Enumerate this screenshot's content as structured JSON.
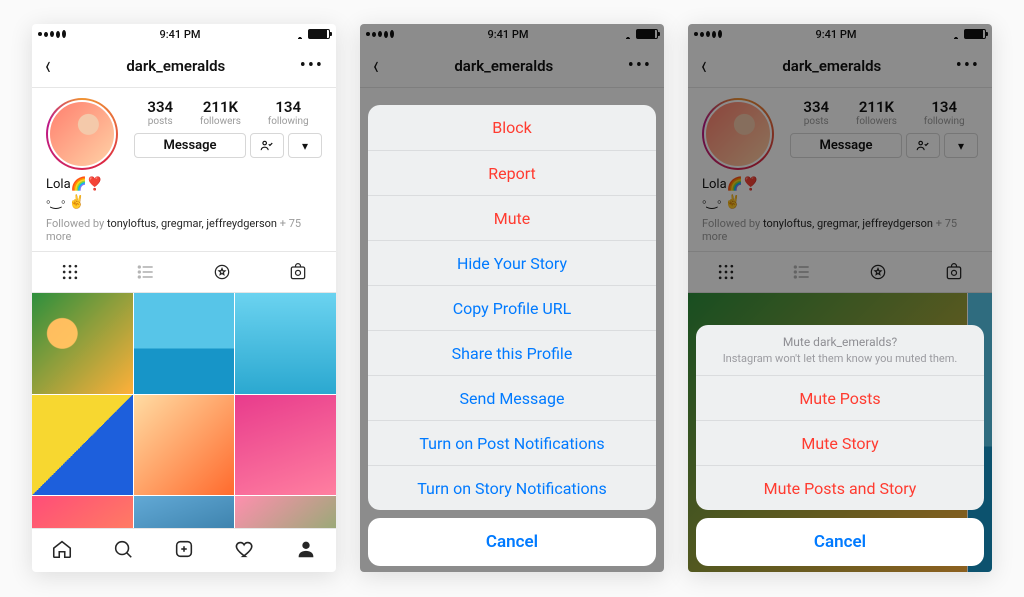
{
  "status": {
    "time": "9:41 PM"
  },
  "header": {
    "username": "dark_emeralds"
  },
  "profile": {
    "posts_count": "334",
    "posts_label": "posts",
    "followers_count": "211K",
    "followers_label": "followers",
    "following_count": "134",
    "following_label": "following",
    "message_label": "Message"
  },
  "bio": {
    "display_name": "Lola🌈❣️",
    "line2": "◦‿◦ ✌️"
  },
  "followed_by": {
    "prefix": "Followed by ",
    "names": "tonyloftus, gregmar, jeffreydgerson",
    "suffix": " + 75 more"
  },
  "action_sheet": {
    "items": [
      {
        "label": "Block",
        "style": "red"
      },
      {
        "label": "Report",
        "style": "red"
      },
      {
        "label": "Mute",
        "style": "red"
      },
      {
        "label": "Hide Your Story",
        "style": "blue"
      },
      {
        "label": "Copy Profile URL",
        "style": "blue"
      },
      {
        "label": "Share this Profile",
        "style": "blue"
      },
      {
        "label": "Send Message",
        "style": "blue"
      },
      {
        "label": "Turn on Post Notifications",
        "style": "blue"
      },
      {
        "label": "Turn on Story Notifications",
        "style": "blue"
      }
    ],
    "cancel": "Cancel"
  },
  "mute_sheet": {
    "question": "Mute dark_emeralds?",
    "subtitle": "Instagram won't let them know you muted them.",
    "items": [
      {
        "label": "Mute Posts",
        "style": "red"
      },
      {
        "label": "Mute Story",
        "style": "red"
      },
      {
        "label": "Mute Posts and Story",
        "style": "red"
      }
    ],
    "cancel": "Cancel"
  }
}
